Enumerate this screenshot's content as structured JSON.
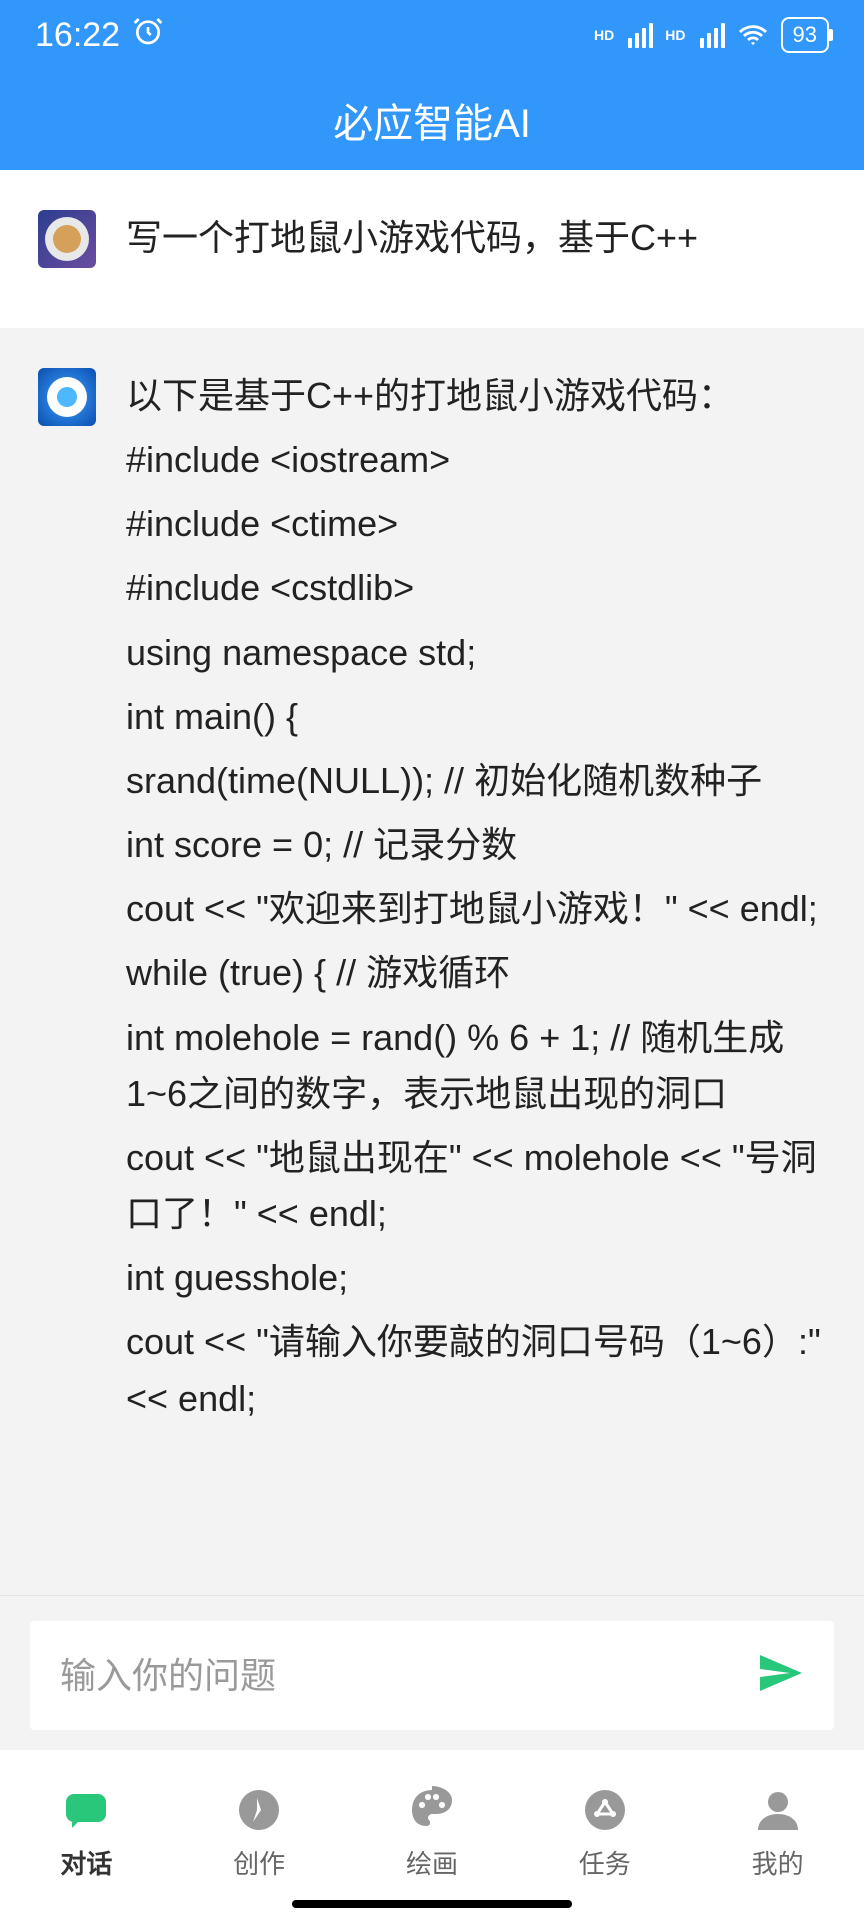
{
  "status": {
    "time": "16:22",
    "battery": "93"
  },
  "header": {
    "title": "必应智能AI"
  },
  "messages": {
    "user": {
      "text": "写一个打地鼠小游戏代码，基于C++"
    },
    "ai": {
      "intro": "以下是基于C++的打地鼠小游戏代码：",
      "lines": [
        "#include <iostream>",
        "#include <ctime>",
        "#include <cstdlib>",
        "using namespace std;",
        "int main() {",
        "    srand(time(NULL)); // 初始化随机数种子",
        "    int score = 0; // 记录分数",
        "    cout << \"欢迎来到打地鼠小游戏！\" << endl;",
        "    while (true) { // 游戏循环",
        "        int molehole = rand() % 6 + 1; // 随机生成1~6之间的数字，表示地鼠出现的洞口",
        "        cout << \"地鼠出现在\" << molehole << \"号洞口了！\" << endl;",
        "        int guesshole;",
        "        cout << \"请输入你要敲的洞口号码（1~6）:\" << endl;"
      ]
    }
  },
  "input": {
    "placeholder": "输入你的问题"
  },
  "nav": {
    "items": [
      {
        "label": "对话"
      },
      {
        "label": "创作"
      },
      {
        "label": "绘画"
      },
      {
        "label": "任务"
      },
      {
        "label": "我的"
      }
    ]
  }
}
